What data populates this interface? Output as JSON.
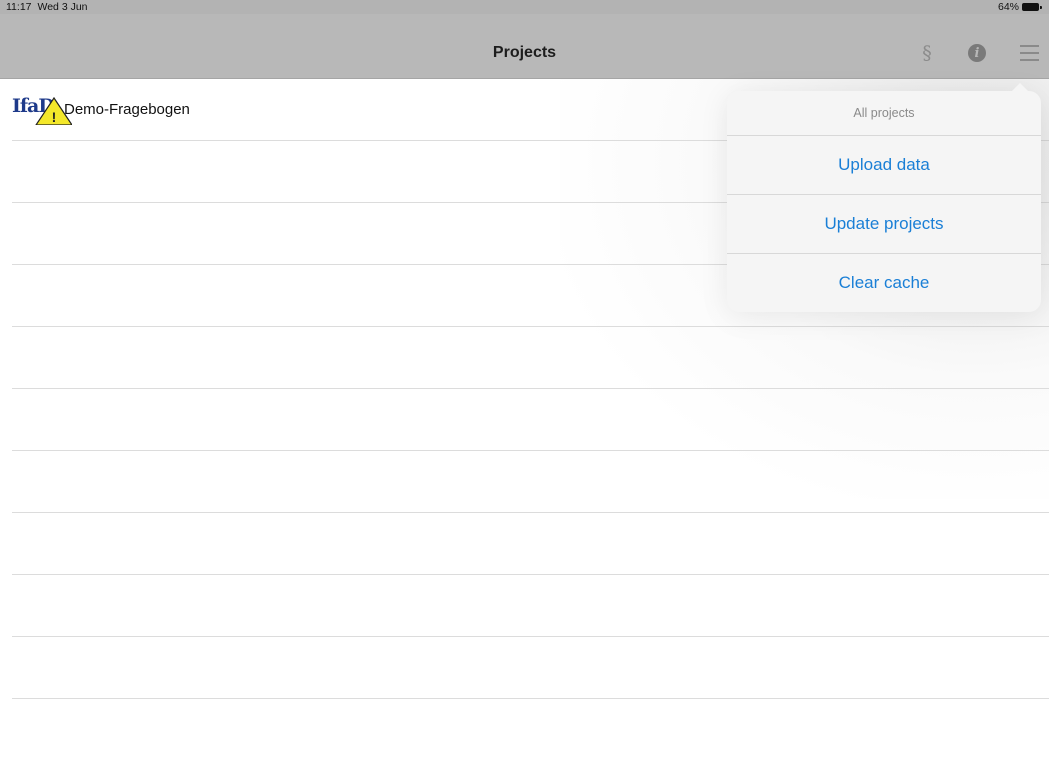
{
  "status_bar": {
    "time": "11:17",
    "date": "Wed 3 Jun",
    "battery": "64%"
  },
  "nav": {
    "title": "Projects",
    "section_symbol": "§",
    "info_symbol": "i"
  },
  "projects": [
    {
      "logo_text": "IfaD",
      "warning_symbol": "!",
      "label": "Demo-Fragebogen"
    }
  ],
  "menu": {
    "header": "All projects",
    "items": [
      {
        "label": "Upload data"
      },
      {
        "label": "Update projects"
      },
      {
        "label": "Clear cache"
      }
    ]
  },
  "colors": {
    "accent": "#1a7fd6",
    "navbar": "#b8b8b8",
    "warning_yellow": "#f4e82a"
  }
}
